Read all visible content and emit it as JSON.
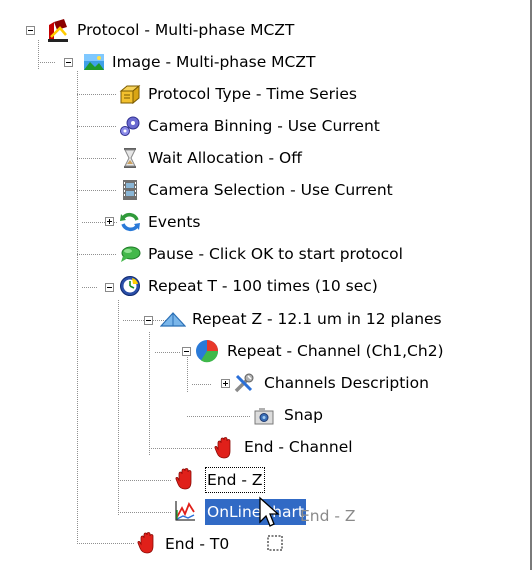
{
  "tree": {
    "nodes": [
      {
        "label": "Protocol - Multi-phase MCZT",
        "icon": "protocol-icon"
      },
      {
        "label": "Image - Multi-phase MCZT",
        "icon": "image-icon"
      },
      {
        "label": "Protocol Type - Time Series",
        "icon": "folders-icon"
      },
      {
        "label": "Camera Binning - Use Current",
        "icon": "gears-icon"
      },
      {
        "label": "Wait Allocation - Off",
        "icon": "hourglass-icon"
      },
      {
        "label": "Camera Selection - Use Current",
        "icon": "film-icon"
      },
      {
        "label": "Events",
        "icon": "refresh-icon"
      },
      {
        "label": "Pause - Click OK to start protocol",
        "icon": "speech-bubble-icon"
      },
      {
        "label": "Repeat T - 100 times (10 sec)",
        "icon": "clock-icon"
      },
      {
        "label": "Repeat Z - 12.1 um in 12 planes",
        "icon": "pyramid-icon"
      },
      {
        "label": "Repeat - Channel (Ch1,Ch2)",
        "icon": "pie-icon"
      },
      {
        "label": "Channels Description",
        "icon": "tools-icon"
      },
      {
        "label": "Snap",
        "icon": "camera-icon"
      },
      {
        "label": "End - Channel",
        "icon": "hand-icon"
      },
      {
        "label": "End - Z",
        "icon": "hand-icon"
      },
      {
        "label": "OnLineChart",
        "icon": "line-chart-icon"
      },
      {
        "label": "End - T0",
        "icon": "hand-icon"
      }
    ],
    "drag_ghost_label": "End - Z"
  },
  "colors": {
    "selection": "#316ac5",
    "hand": "#e0201a",
    "tree_lines": "#909090"
  }
}
